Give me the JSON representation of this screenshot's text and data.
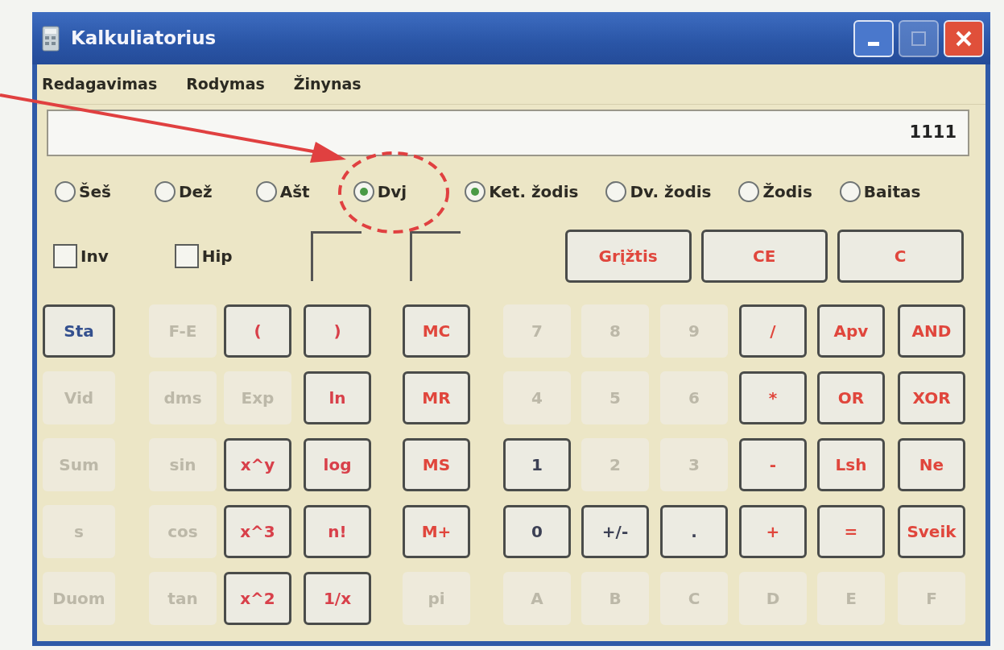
{
  "window": {
    "title": "Kalkuliatorius"
  },
  "menu": [
    {
      "label": "Redagavimas"
    },
    {
      "label": "Rodymas"
    },
    {
      "label": "Žinynas"
    }
  ],
  "display": {
    "value": "1111"
  },
  "number_system": [
    {
      "label": "Šeš",
      "selected": false
    },
    {
      "label": "Dež",
      "selected": false
    },
    {
      "label": "Ašt",
      "selected": false
    },
    {
      "label": "Dvj",
      "selected": true
    }
  ],
  "word_size": [
    {
      "label": "Ket. žodis",
      "selected": true
    },
    {
      "label": "Dv. žodis",
      "selected": false
    },
    {
      "label": "Žodis",
      "selected": false
    },
    {
      "label": "Baitas",
      "selected": false
    }
  ],
  "checkboxes": [
    {
      "label": "Inv",
      "checked": false
    },
    {
      "label": "Hip",
      "checked": false
    }
  ],
  "edit_buttons": [
    {
      "label": "Grįžtis",
      "color": "#e0463c"
    },
    {
      "label": "CE",
      "color": "#e0463c"
    },
    {
      "label": "C",
      "color": "#e0463c"
    }
  ],
  "keypad": [
    [
      {
        "label": "Sta",
        "disabled": false,
        "color": "#34508e"
      },
      {
        "label": "F-E",
        "disabled": true
      },
      {
        "label": "(",
        "disabled": false,
        "color": "#d8404a"
      },
      {
        "label": ")",
        "disabled": false,
        "color": "#d8404a"
      },
      {
        "label": "MC",
        "disabled": false,
        "color": "#e0463c"
      },
      {
        "label": "7",
        "disabled": true
      },
      {
        "label": "8",
        "disabled": true
      },
      {
        "label": "9",
        "disabled": true
      },
      {
        "label": "/",
        "disabled": false,
        "color": "#e0463c"
      },
      {
        "label": "Apv",
        "disabled": false,
        "color": "#e0463c"
      },
      {
        "label": "AND",
        "disabled": false,
        "color": "#e0463c"
      }
    ],
    [
      {
        "label": "Vid",
        "disabled": true
      },
      {
        "label": "dms",
        "disabled": true
      },
      {
        "label": "Exp",
        "disabled": true
      },
      {
        "label": "ln",
        "disabled": false,
        "color": "#d8404a"
      },
      {
        "label": "MR",
        "disabled": false,
        "color": "#e0463c"
      },
      {
        "label": "4",
        "disabled": true
      },
      {
        "label": "5",
        "disabled": true
      },
      {
        "label": "6",
        "disabled": true
      },
      {
        "label": "*",
        "disabled": false,
        "color": "#e0463c"
      },
      {
        "label": "OR",
        "disabled": false,
        "color": "#e0463c"
      },
      {
        "label": "XOR",
        "disabled": false,
        "color": "#e0463c"
      }
    ],
    [
      {
        "label": "Sum",
        "disabled": true
      },
      {
        "label": "sin",
        "disabled": true
      },
      {
        "label": "x^y",
        "disabled": false,
        "color": "#d8404a"
      },
      {
        "label": "log",
        "disabled": false,
        "color": "#d8404a"
      },
      {
        "label": "MS",
        "disabled": false,
        "color": "#e0463c"
      },
      {
        "label": "1",
        "disabled": false,
        "color": "#3c4054"
      },
      {
        "label": "2",
        "disabled": true
      },
      {
        "label": "3",
        "disabled": true
      },
      {
        "label": "-",
        "disabled": false,
        "color": "#e0463c"
      },
      {
        "label": "Lsh",
        "disabled": false,
        "color": "#e0463c"
      },
      {
        "label": "Ne",
        "disabled": false,
        "color": "#e0463c"
      }
    ],
    [
      {
        "label": "s",
        "disabled": true
      },
      {
        "label": "cos",
        "disabled": true
      },
      {
        "label": "x^3",
        "disabled": false,
        "color": "#d8404a"
      },
      {
        "label": "n!",
        "disabled": false,
        "color": "#d8404a"
      },
      {
        "label": "M+",
        "disabled": false,
        "color": "#e0463c"
      },
      {
        "label": "0",
        "disabled": false,
        "color": "#3c4054"
      },
      {
        "label": "+/-",
        "disabled": false,
        "color": "#3c4054"
      },
      {
        "label": ".",
        "disabled": false,
        "color": "#3c4054"
      },
      {
        "label": "+",
        "disabled": false,
        "color": "#e0463c"
      },
      {
        "label": "=",
        "disabled": false,
        "color": "#e0463c"
      },
      {
        "label": "Sveik",
        "disabled": false,
        "color": "#e0463c"
      }
    ],
    [
      {
        "label": "Duom",
        "disabled": true
      },
      {
        "label": "tan",
        "disabled": true
      },
      {
        "label": "x^2",
        "disabled": false,
        "color": "#d8404a"
      },
      {
        "label": "1/x",
        "disabled": false,
        "color": "#d8404a"
      },
      {
        "label": "pi",
        "disabled": true
      },
      {
        "label": "A",
        "disabled": true
      },
      {
        "label": "B",
        "disabled": true
      },
      {
        "label": "C",
        "disabled": true
      },
      {
        "label": "D",
        "disabled": true
      },
      {
        "label": "E",
        "disabled": true
      },
      {
        "label": "F",
        "disabled": true
      }
    ]
  ]
}
